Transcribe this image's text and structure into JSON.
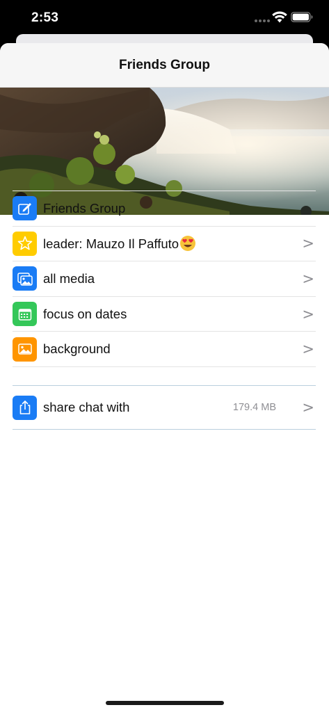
{
  "status_bar": {
    "time": "2:53"
  },
  "nav": {
    "title": "Friends Group"
  },
  "settings": [
    {
      "label": "Friends Group",
      "icon": "compose-icon",
      "color": "#1a7cf5",
      "has_chevron": false
    },
    {
      "label": "leader: Mauzo Il Paffuto",
      "icon": "star-icon",
      "color": "#ffcc00",
      "has_chevron": true,
      "emoji": "heart-eyes-emoji-icon"
    },
    {
      "label": "all media",
      "icon": "photos-icon",
      "color": "#1a7cf5",
      "has_chevron": true
    },
    {
      "label": "focus on dates",
      "icon": "calendar-icon",
      "color": "#34c759",
      "has_chevron": true
    },
    {
      "label": "background",
      "icon": "image-icon",
      "color": "#ff9500",
      "has_chevron": true
    }
  ],
  "share": {
    "label": "share chat with",
    "size": "179.4 MB",
    "icon": "share-icon",
    "color": "#1a7cf5"
  },
  "chevron": ">"
}
